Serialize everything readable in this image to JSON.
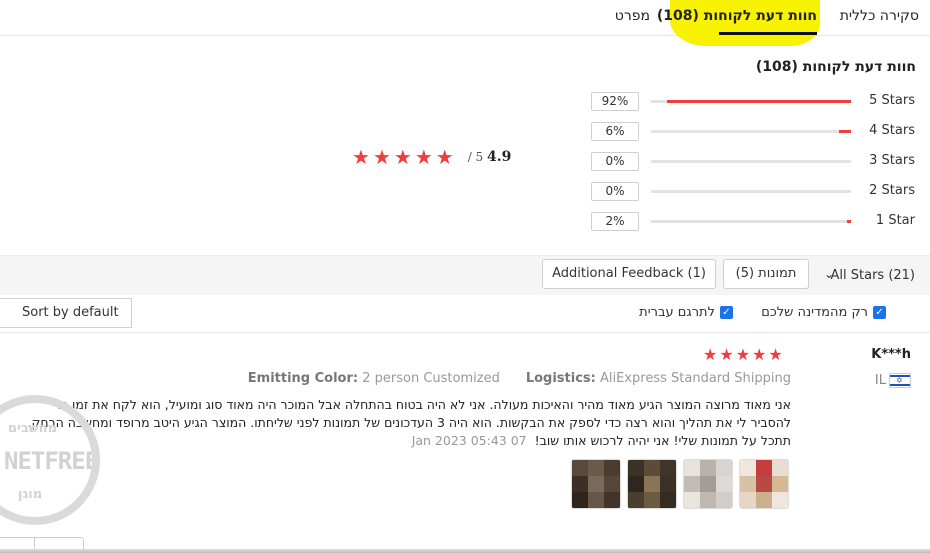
{
  "tabs": {
    "overview": "סקירה כללית",
    "reviews": "חוות דעת לקוחות (108)",
    "specs": "מפרט"
  },
  "ratings": {
    "title": "חוות דעת לקוחות (108)",
    "average": "4.9",
    "average_suffix": "/ 5",
    "stars_shown": 5,
    "bars": [
      {
        "label": "5 Stars",
        "pct": "92%",
        "fraction": 0.92
      },
      {
        "label": "4 Stars",
        "pct": "6%",
        "fraction": 0.06
      },
      {
        "label": "3 Stars",
        "pct": "0%",
        "fraction": 0
      },
      {
        "label": "2 Stars",
        "pct": "0%",
        "fraction": 0
      },
      {
        "label": "1 Star",
        "pct": "2%",
        "fraction": 0.02
      }
    ]
  },
  "filters": {
    "all_stars": "All Stars (21)",
    "photos": "תמונות (5)",
    "additional": "Additional Feedback (1)",
    "sort": "Sort by default",
    "country_only": "רק מהמדינה שלכם",
    "translate": "לתרגם עברית"
  },
  "review": {
    "reviewer": "K***h",
    "country_code": "IL",
    "stars": 5,
    "color_label": "Emitting Color:",
    "color_value": "2 person Customized",
    "logistics_label": "Logistics:",
    "logistics_value": "AliExpress Standard Shipping",
    "text_line1": "אני מאוד מרוצה המוצר הגיע מאוד מהיר והאיכות מעולה. אני לא היה בטוח בהתחלה אבל המוכר היה מאוד סוג ומועיל, הוא לקח את זמן כדי",
    "text_line2": "להסביר לי את תהליך והוא רצה כדי לספק את הבקשות. הוא היה 3 העדכונים של תמונות לפני שליחתו. המוצר הגיע היטב מרופד ומחשבה הרחק.",
    "text_line3": "תתכל על תמונות שלי! אני יהיה לרכוש אותו שוב!",
    "date": "07 Jan 2023 05:43"
  },
  "watermark": {
    "top": "מחשבים",
    "mid": "NETFREE",
    "bottom": "מוגן"
  },
  "colors": {
    "accent": "#f03d3d",
    "highlight": "#f6f200",
    "checkbox": "#1a73e8"
  }
}
